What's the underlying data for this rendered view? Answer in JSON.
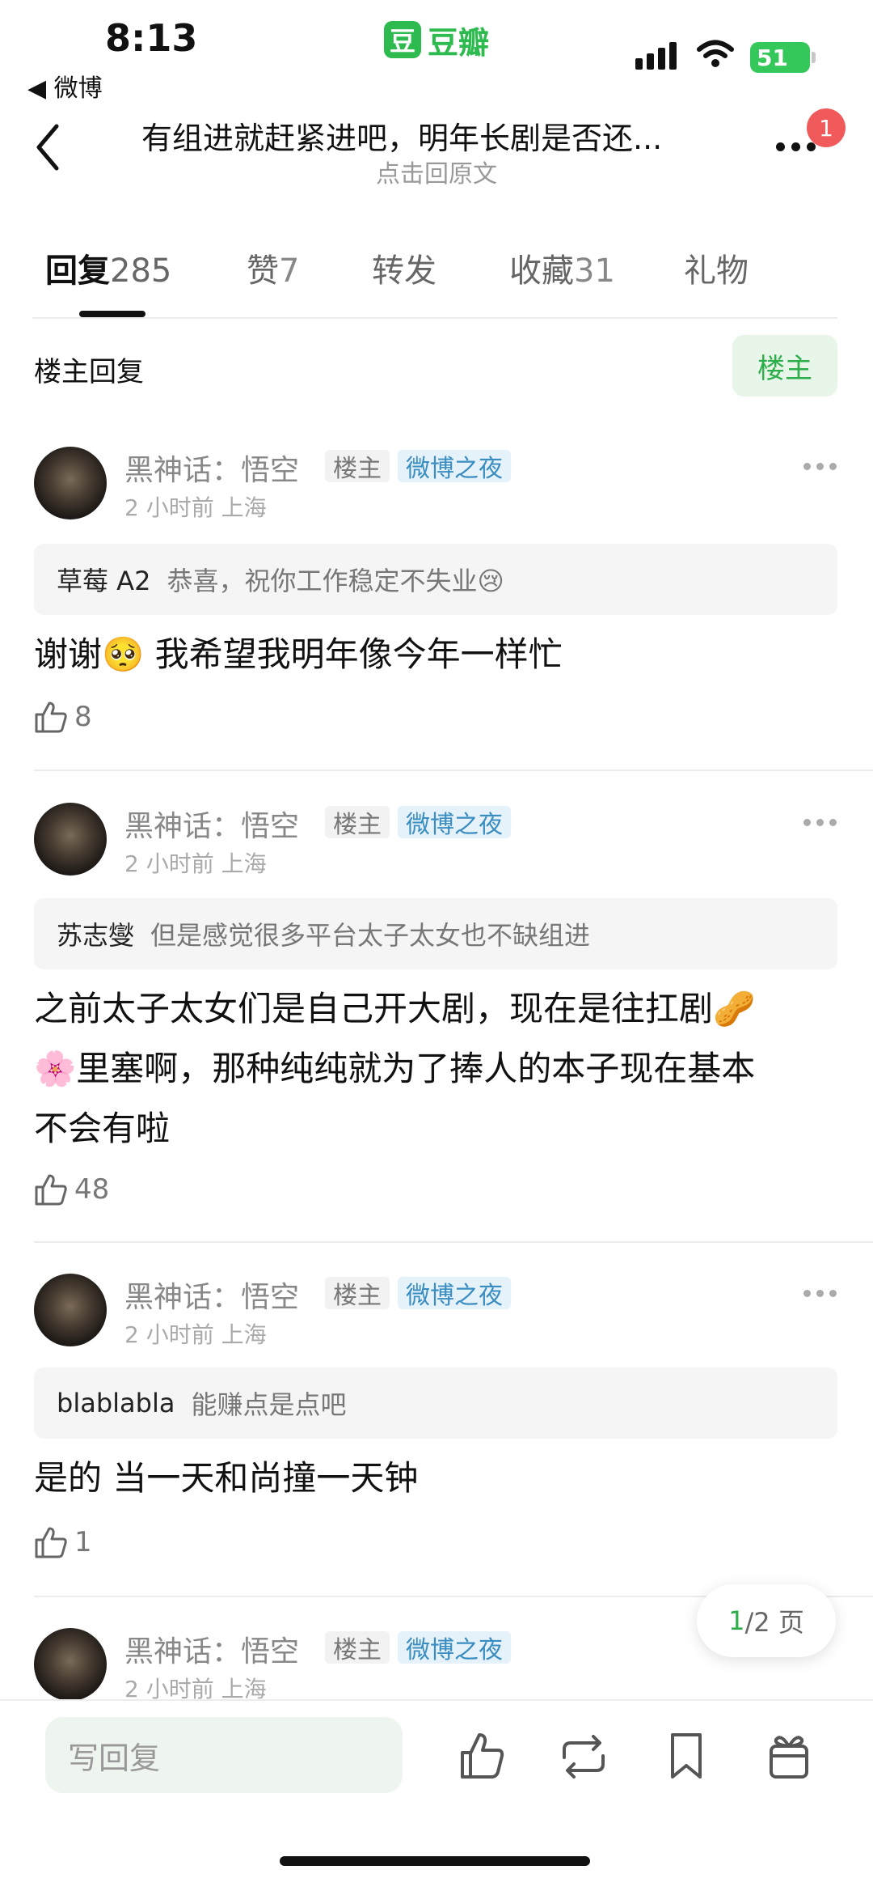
{
  "status_bar": {
    "time": "8:13",
    "back_app": "◀ 微博",
    "app_logo": "豆",
    "app_name": "豆瓣",
    "battery": "51"
  },
  "header": {
    "title": "有组进就赶紧进吧，明年长剧是否还...",
    "subtitle": "点击回原文",
    "notification_count": "1"
  },
  "tabs": [
    {
      "label": "回复",
      "count": "285"
    },
    {
      "label": "赞",
      "count": "7"
    },
    {
      "label": "转发",
      "count": ""
    },
    {
      "label": "收藏",
      "count": "31"
    },
    {
      "label": "礼物",
      "count": ""
    }
  ],
  "section": {
    "title": "楼主回复",
    "owner_button": "楼主"
  },
  "comments": [
    {
      "user": "黑神话：悟空",
      "tag_owner": "楼主",
      "tag_event": "微博之夜",
      "meta": "2 小时前 上海",
      "quote_name": "草莓 A2",
      "quote_text": "恭喜，祝你工作稳定不失业😢",
      "text_lines": [
        "谢谢🥺 我希望我明年像今年一样忙"
      ],
      "likes": "8"
    },
    {
      "user": "黑神话：悟空",
      "tag_owner": "楼主",
      "tag_event": "微博之夜",
      "meta": "2 小时前 上海",
      "quote_name": "苏志燮",
      "quote_text": "但是感觉很多平台太子太女也不缺组进",
      "text_lines": [
        "之前太子太女们是自己开大剧，现在是往扛剧🥜",
        "🌸里塞啊，那种纯纯就为了捧人的本子现在基本",
        "不会有啦"
      ],
      "likes": "48"
    },
    {
      "user": "黑神话：悟空",
      "tag_owner": "楼主",
      "tag_event": "微博之夜",
      "meta": "2 小时前 上海",
      "quote_name": "blablabla",
      "quote_text": "能赚点是点吧",
      "text_lines": [
        "是的 当一天和尚撞一天钟"
      ],
      "likes": "1"
    },
    {
      "user": "黑神话：悟空",
      "tag_owner": "楼主",
      "tag_event": "微博之夜",
      "meta": "2 小时前 上海"
    }
  ],
  "pager": {
    "current": "1",
    "rest": "/2 页"
  },
  "bottom_bar": {
    "reply_placeholder": "写回复"
  }
}
